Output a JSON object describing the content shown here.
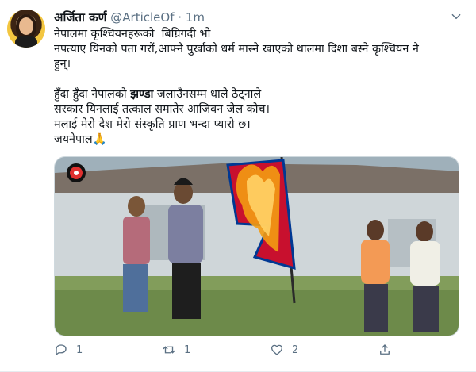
{
  "tweet": {
    "author_name": "अर्जिता कर्ण",
    "handle": "@ArticleOf",
    "separator": "·",
    "time": "1m",
    "text_lines": [
      "नेपालमा कृश्चियनहरूको  बिग्रिगदी भो",
      "नपत्याए यिनको पता गरौं,आफ्नै पुर्खाको धर्म मास्ने खाएको थालमा दिशा बस्ने कृश्चियन नै",
      "हुन्।",
      "",
      "हुँदा हुँदा नेपालको ",
      "झण्डा",
      " जलाउँनसम्म धाले ठेट्नाले",
      "सरकार यिनलाई तत्काल समातेर आजिवन जेल कोच।",
      "मलाई मेरो देश मेरो संस्कृति प्राण भन्दा प्यारो छ।",
      "जयनेपाल🙏"
    ],
    "actions": {
      "reply_count": "1",
      "retweet_count": "1",
      "like_count": "2"
    }
  },
  "icons": {
    "reply": "reply-icon",
    "retweet": "retweet-icon",
    "like": "like-icon",
    "share": "share-icon",
    "more": "chevron-down-icon",
    "channel_logo": "channel-logo-icon"
  },
  "colors": {
    "secondary_text": "#5b7083",
    "flag_red": "#c8102e",
    "flag_blue": "#003893",
    "fire": "#f39c12"
  }
}
